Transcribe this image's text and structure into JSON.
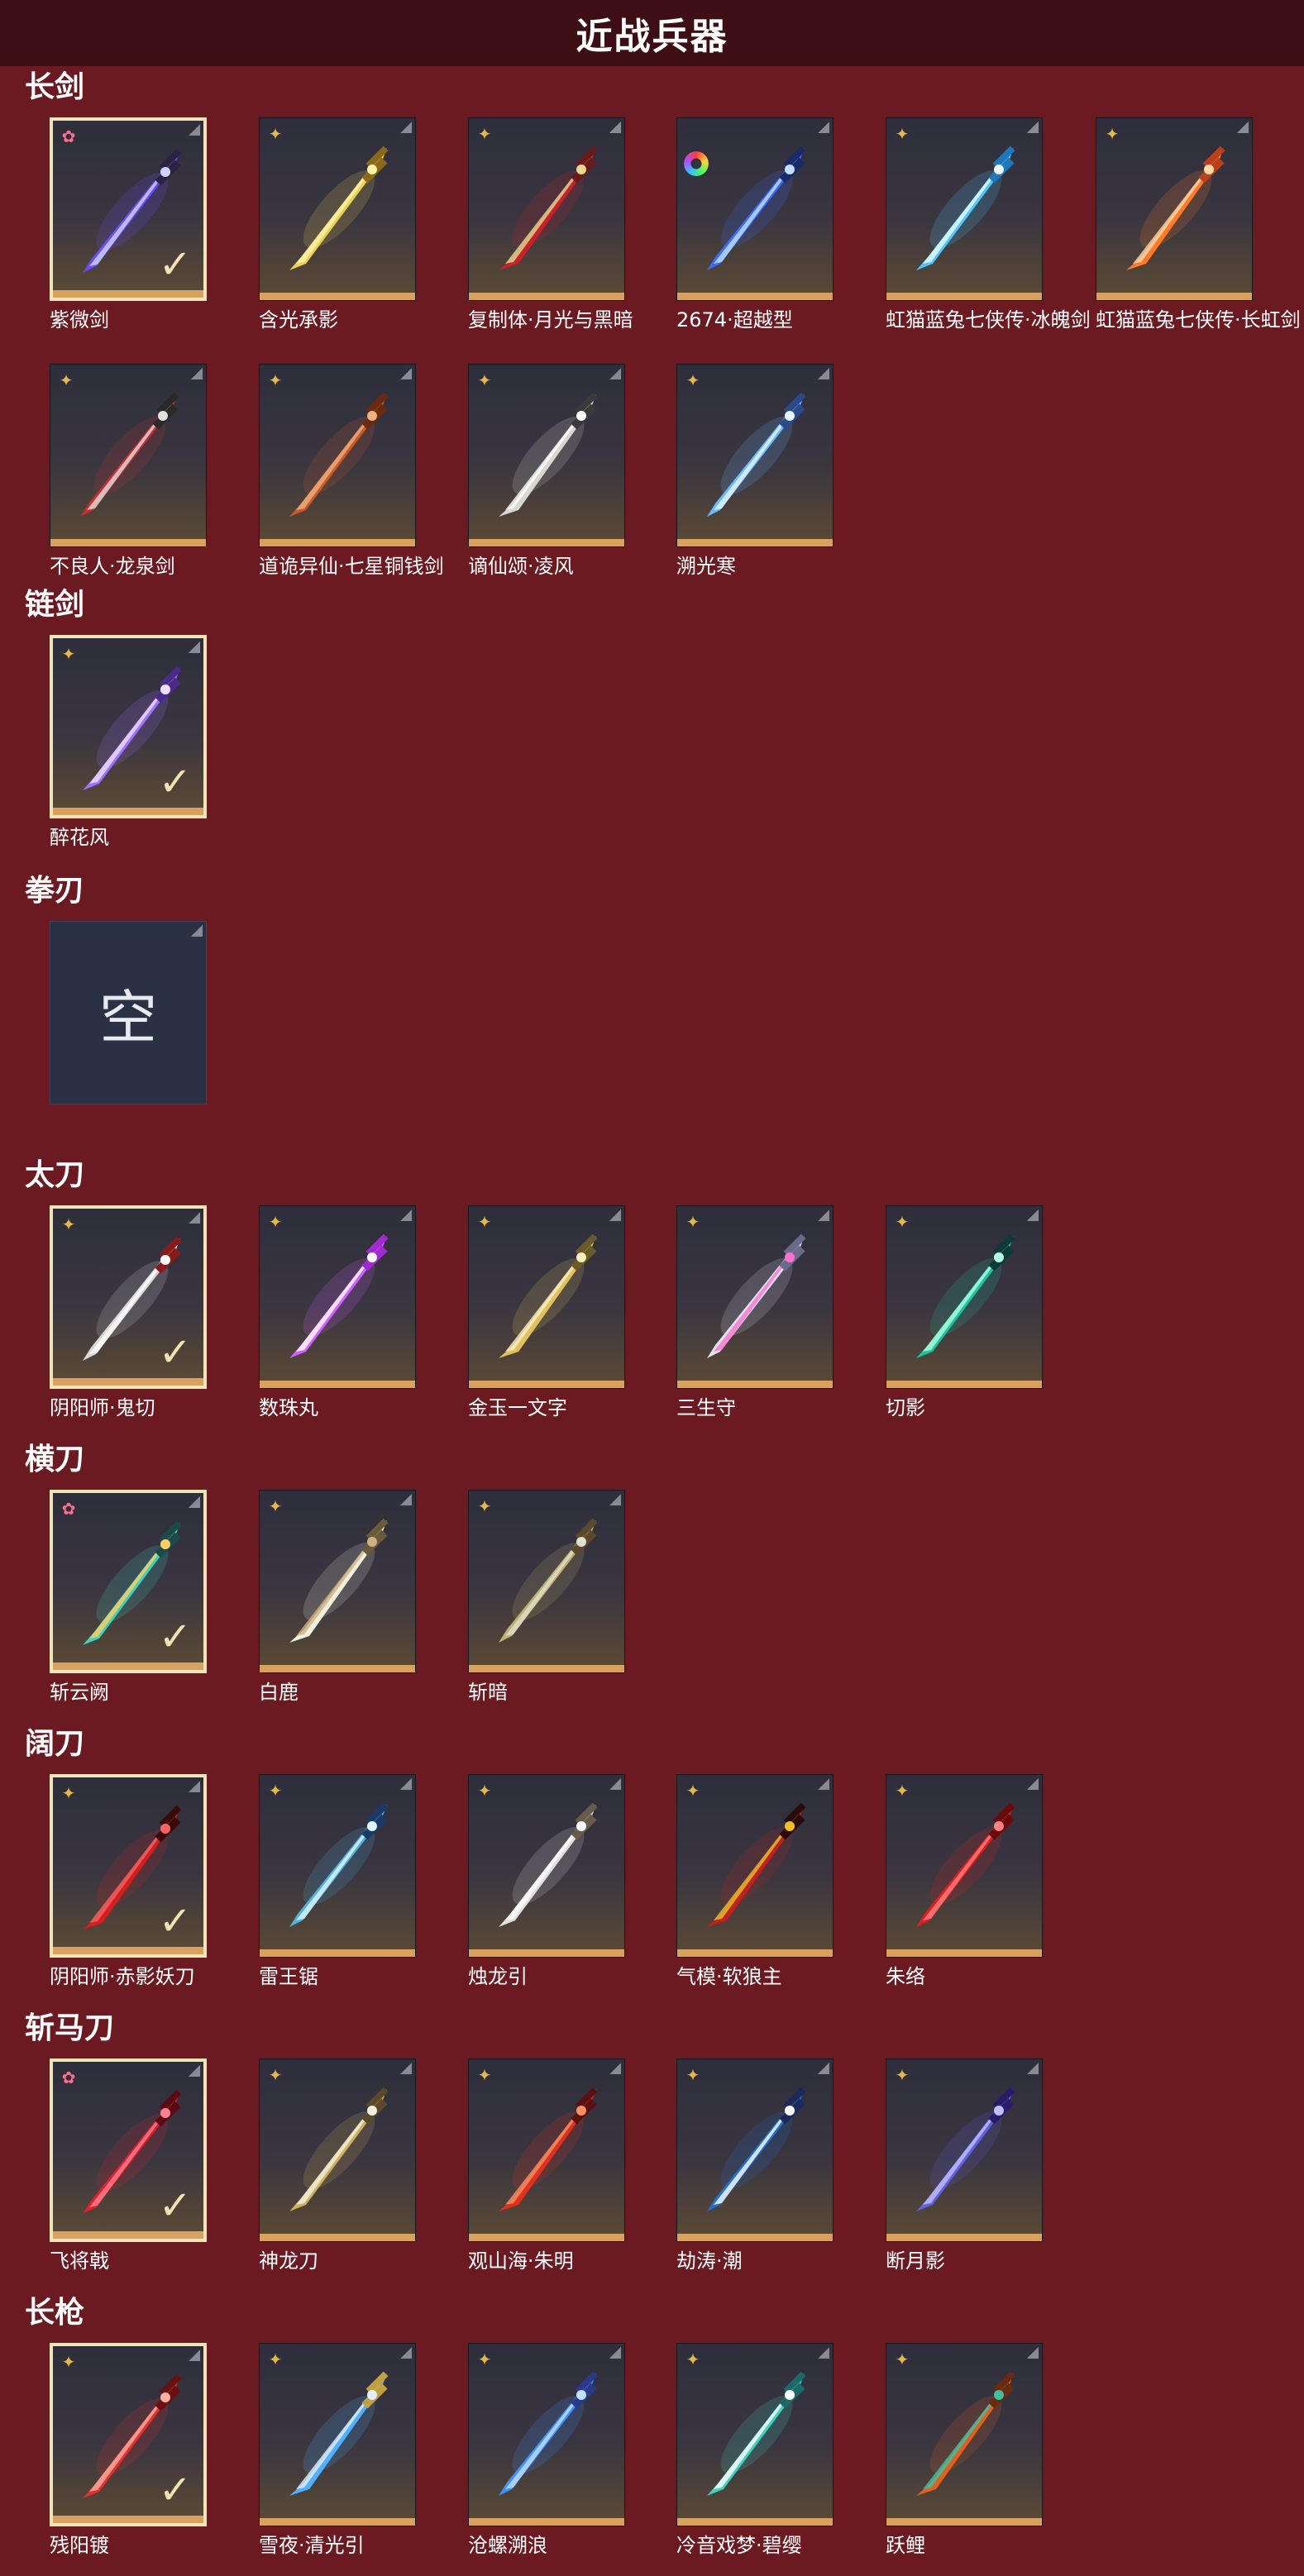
{
  "page_title": "近战兵器",
  "sections": [
    {
      "title": "长剑",
      "rows": [
        [
          {
            "name": "紫微剑",
            "badge": "pink",
            "equipped": true,
            "colors": [
              "#6a4cff",
              "#cfd4ff",
              "#2b2342"
            ]
          },
          {
            "name": "含光承影",
            "badge": "gold",
            "equipped": false,
            "colors": [
              "#e8cf5a",
              "#fff3a6",
              "#8a6a1a"
            ]
          },
          {
            "name": "复制体·月光与黑暗",
            "badge": "gold",
            "equipped": false,
            "colors": [
              "#c8202c",
              "#e8d890",
              "#6a1a1a"
            ]
          },
          {
            "name": "2674·超越型",
            "badge": "rainbow",
            "equipped": false,
            "colors": [
              "#3e6bff",
              "#bfe2ff",
              "#1a2a6a"
            ]
          },
          {
            "name": "虹猫蓝兔七侠传·冰魄剑",
            "badge": "gold",
            "equipped": false,
            "colors": [
              "#4fc6ff",
              "#eafcff",
              "#1e77b8"
            ]
          },
          {
            "name": "虹猫蓝兔七侠传·长虹剑",
            "badge": "gold",
            "equipped": false,
            "colors": [
              "#ff7a2a",
              "#ffd8a8",
              "#b8401a"
            ]
          }
        ],
        [
          {
            "name": "不良人·龙泉剑",
            "badge": "gold",
            "equipped": false,
            "colors": [
              "#c03030",
              "#e0e0e0",
              "#2a2a2a"
            ]
          },
          {
            "name": "道诡异仙·七星铜钱剑",
            "badge": "gold",
            "equipped": false,
            "colors": [
              "#c85a2a",
              "#f0b080",
              "#6a2a10"
            ]
          },
          {
            "name": "谪仙颂·凌风",
            "badge": "gold",
            "equipped": false,
            "colors": [
              "#d8d8d0",
              "#ffffff",
              "#3a3a3a"
            ]
          },
          {
            "name": "溯光寒",
            "badge": "gold",
            "equipped": false,
            "colors": [
              "#6ab8ff",
              "#e8f6ff",
              "#2a4a8a"
            ]
          }
        ]
      ]
    },
    {
      "title": "链剑",
      "rows": [
        [
          {
            "name": "醉花风",
            "badge": "gold",
            "equipped": true,
            "colors": [
              "#a070ff",
              "#f0e0ff",
              "#4a2a8a"
            ]
          }
        ]
      ]
    },
    {
      "title": "拳刃",
      "rows": [
        [
          {
            "name": "",
            "badge": "none",
            "equipped": false,
            "empty": true,
            "empty_label": "空",
            "colors": [
              "#e8eaf0",
              "#e8eaf0",
              "#e8eaf0"
            ]
          }
        ]
      ]
    },
    {
      "title": "太刀",
      "rows": [
        [
          {
            "name": "阴阳师·鬼切",
            "badge": "gold",
            "equipped": true,
            "colors": [
              "#d8d8d8",
              "#ffffff",
              "#8a1a1a"
            ]
          },
          {
            "name": "数珠丸",
            "badge": "gold",
            "equipped": false,
            "colors": [
              "#d060ff",
              "#ffffff",
              "#a02ad0"
            ]
          },
          {
            "name": "金玉一文字",
            "badge": "gold",
            "equipped": false,
            "colors": [
              "#e0c060",
              "#fff0c0",
              "#6a5a2a"
            ]
          },
          {
            "name": "三生守",
            "badge": "gold",
            "equipped": false,
            "colors": [
              "#e0e0f0",
              "#ff70d0",
              "#6a6a8a"
            ]
          },
          {
            "name": "切影",
            "badge": "gold",
            "equipped": false,
            "colors": [
              "#20c0a0",
              "#b0ffe0",
              "#0a3a3a"
            ]
          }
        ]
      ]
    },
    {
      "title": "横刀",
      "rows": [
        [
          {
            "name": "斩云阙",
            "badge": "pink",
            "equipped": true,
            "colors": [
              "#40d0c0",
              "#ffd060",
              "#1a4a4a"
            ]
          },
          {
            "name": "白鹿",
            "badge": "gold",
            "equipped": false,
            "colors": [
              "#f0f0e0",
              "#d0b080",
              "#6a5a3a"
            ]
          },
          {
            "name": "斩暗",
            "badge": "gold",
            "equipped": false,
            "colors": [
              "#c0b070",
              "#e0e0d0",
              "#5a4a2a"
            ]
          }
        ]
      ]
    },
    {
      "title": "阔刀",
      "rows": [
        [
          {
            "name": "阴阳师·赤影妖刀",
            "badge": "gold",
            "equipped": true,
            "colors": [
              "#d02020",
              "#ff6060",
              "#3a0a0a"
            ]
          },
          {
            "name": "雷王锯",
            "badge": "gold",
            "equipped": false,
            "colors": [
              "#50b0e0",
              "#e0f8ff",
              "#1a3a6a"
            ]
          },
          {
            "name": "烛龙引",
            "badge": "gold",
            "equipped": false,
            "colors": [
              "#e0e0e0",
              "#ffffff",
              "#6a5a4a"
            ]
          },
          {
            "name": "气模·软狼主",
            "badge": "gold",
            "equipped": false,
            "colors": [
              "#c02020",
              "#f0c020",
              "#2a0a0a"
            ]
          },
          {
            "name": "朱络",
            "badge": "gold",
            "equipped": false,
            "colors": [
              "#e02020",
              "#ff8080",
              "#6a0a0a"
            ]
          }
        ]
      ]
    },
    {
      "title": "斩马刀",
      "rows": [
        [
          {
            "name": "飞将戟",
            "badge": "pink",
            "equipped": true,
            "colors": [
              "#e02030",
              "#ff8090",
              "#5a0a10"
            ]
          },
          {
            "name": "神龙刀",
            "badge": "gold",
            "equipped": false,
            "colors": [
              "#d0b060",
              "#f0f0e0",
              "#5a4a2a"
            ]
          },
          {
            "name": "观山海·朱明",
            "badge": "gold",
            "equipped": false,
            "colors": [
              "#e03020",
              "#ff9060",
              "#5a1010"
            ]
          },
          {
            "name": "劫涛·潮",
            "badge": "gold",
            "equipped": false,
            "colors": [
              "#2070d0",
              "#ffffff",
              "#1a2a5a"
            ]
          },
          {
            "name": "断月影",
            "badge": "gold",
            "equipped": false,
            "colors": [
              "#6060e0",
              "#c0c0ff",
              "#2a1a6a"
            ]
          }
        ]
      ]
    },
    {
      "title": "长枪",
      "rows": [
        [
          {
            "name": "残阳镀",
            "badge": "gold",
            "equipped": true,
            "colors": [
              "#e03030",
              "#ffb0a0",
              "#6a1010"
            ]
          },
          {
            "name": "雪夜·清光引",
            "badge": "gold",
            "equipped": false,
            "colors": [
              "#50b0ff",
              "#e0f0ff",
              "#c0a040"
            ]
          },
          {
            "name": "沧螺溯浪",
            "badge": "gold",
            "equipped": false,
            "colors": [
              "#4090ff",
              "#c0e0ff",
              "#2a3a8a"
            ]
          },
          {
            "name": "冷音戏梦·碧缨",
            "badge": "gold",
            "equipped": false,
            "colors": [
              "#40d0c0",
              "#ffffff",
              "#1a6a6a"
            ]
          },
          {
            "name": "跃鲤",
            "badge": "gold",
            "equipped": false,
            "colors": [
              "#e06020",
              "#40c0a0",
              "#6a2a10"
            ]
          }
        ]
      ]
    }
  ]
}
